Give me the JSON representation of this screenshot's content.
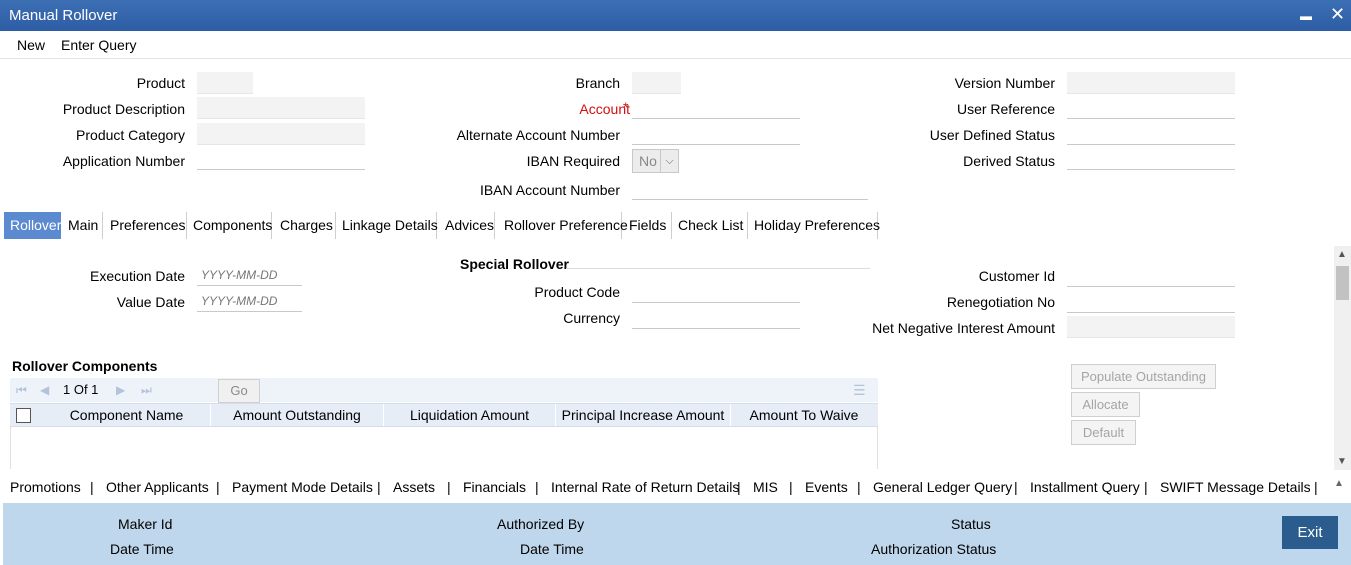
{
  "window": {
    "title": "Manual Rollover",
    "minimize": "▬",
    "close": "✕"
  },
  "menu": {
    "new": "New",
    "enter_query": "Enter Query"
  },
  "header": {
    "product": {
      "label": "Product",
      "value": ""
    },
    "product_description": {
      "label": "Product Description",
      "value": ""
    },
    "product_category": {
      "label": "Product Category",
      "value": ""
    },
    "application_number": {
      "label": "Application Number",
      "value": ""
    },
    "branch": {
      "label": "Branch",
      "value": ""
    },
    "account": {
      "label": "Account",
      "required_mark": "*",
      "value": ""
    },
    "alternate_account_number": {
      "label": "Alternate Account Number",
      "value": ""
    },
    "iban_required": {
      "label": "IBAN Required",
      "value": "No"
    },
    "iban_account_number": {
      "label": "IBAN Account Number",
      "value": ""
    },
    "version_number": {
      "label": "Version Number",
      "value": ""
    },
    "user_reference": {
      "label": "User Reference",
      "value": ""
    },
    "user_defined_status": {
      "label": "User Defined Status",
      "value": ""
    },
    "derived_status": {
      "label": "Derived Status",
      "value": ""
    }
  },
  "tabs": [
    "Rollover",
    "Main",
    "Preferences",
    "Components",
    "Charges",
    "Linkage Details",
    "Advices",
    "Rollover Preference",
    "Fields",
    "Check List",
    "Holiday Preferences"
  ],
  "active_tab": "Rollover",
  "rollover": {
    "execution_date": {
      "label": "Execution Date",
      "placeholder": "YYYY-MM-DD"
    },
    "value_date": {
      "label": "Value Date",
      "placeholder": "YYYY-MM-DD"
    },
    "special_rollover_title": "Special Rollover",
    "product_code": {
      "label": "Product Code",
      "value": ""
    },
    "currency": {
      "label": "Currency",
      "value": ""
    },
    "customer_id": {
      "label": "Customer Id",
      "value": ""
    },
    "renegotiation_no": {
      "label": "Renegotiation No",
      "value": ""
    },
    "net_negative_interest_amount": {
      "label": "Net Negative Interest Amount",
      "value": ""
    }
  },
  "components": {
    "title": "Rollover Components",
    "pagination": {
      "page_text": "1 Of 1",
      "go_label": "Go"
    },
    "columns": [
      "Component Name",
      "Amount Outstanding",
      "Liquidation Amount",
      "Principal Increase Amount",
      "Amount To Waive"
    ],
    "rows": []
  },
  "actions": {
    "populate_outstanding": "Populate Outstanding",
    "allocate": "Allocate",
    "default": "Default"
  },
  "bottom_links": [
    "Promotions",
    "Other Applicants",
    "Payment Mode Details",
    "Assets",
    "Financials",
    "Internal Rate of Return Details",
    "MIS",
    "Events",
    "General Ledger Query",
    "Installment Query",
    "SWIFT Message Details"
  ],
  "footer": {
    "maker_id": "Maker Id",
    "date_time_1": "Date Time",
    "authorized_by": "Authorized By",
    "date_time_2": "Date Time",
    "status": "Status",
    "authorization_status": "Authorization Status",
    "exit_label": "Exit"
  },
  "colors": {
    "title_bar": "#2d5da4",
    "active_tab": "#5b8ad0",
    "footer_bg": "#bfd7ec",
    "exit_button": "#2a5d8e",
    "required": "#d01010"
  }
}
